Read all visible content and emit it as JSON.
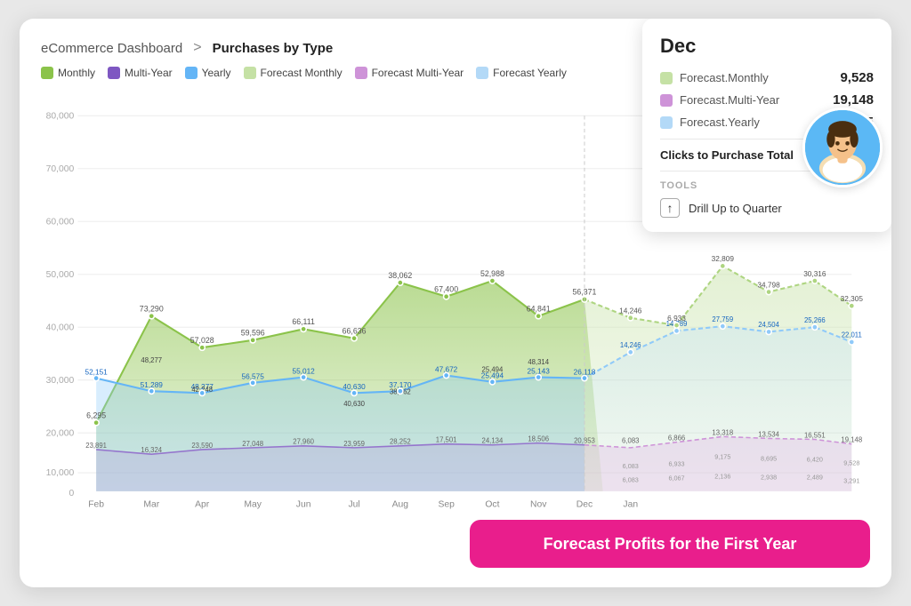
{
  "breadcrumb": {
    "parent": "eCommerce Dashboard",
    "separator": ">",
    "current": "Purchases by Type"
  },
  "legend": {
    "items": [
      {
        "label": "Monthly",
        "color": "#8bc34a"
      },
      {
        "label": "Multi-Year",
        "color": "#7e57c2"
      },
      {
        "label": "Yearly",
        "color": "#64b5f6"
      },
      {
        "label": "Forecast Monthly",
        "color": "#c5e1a5"
      },
      {
        "label": "Forecast Multi-Year",
        "color": "#ce93d8"
      },
      {
        "label": "Forecast Yearly",
        "color": "#b3d9f7"
      }
    ]
  },
  "tooltip": {
    "month": "Dec",
    "rows": [
      {
        "label": "Forecast.Monthly",
        "color": "#c5e1a5",
        "value": "9,528"
      },
      {
        "label": "Forecast.Multi-Year",
        "color": "#ce93d8",
        "value": "19,148"
      },
      {
        "label": "Forecast.Yearly",
        "color": "#b3d9f7",
        "value": "32,305"
      }
    ],
    "total_label": "Clicks to Purchase Total",
    "tools_label": "TOOLS",
    "drill_label": "Drill Up to Quarter"
  },
  "cta": {
    "label": "Forecast Profits for the First Year"
  },
  "colors": {
    "monthly_fill": "#8bc34a",
    "monthly_stroke": "#7cb342",
    "forecast_monthly_fill": "#c5e1a5",
    "forecast_monthly_stroke": "#aed581",
    "yearly_fill": "#90caf9",
    "yearly_stroke": "#64b5f6",
    "forecast_yearly_fill": "#bbdefb",
    "forecast_yearly_stroke": "#90caf9",
    "multiyear_fill": "#b39ddb",
    "multiyear_stroke": "#9575cd",
    "pink": "#e91e8c"
  }
}
